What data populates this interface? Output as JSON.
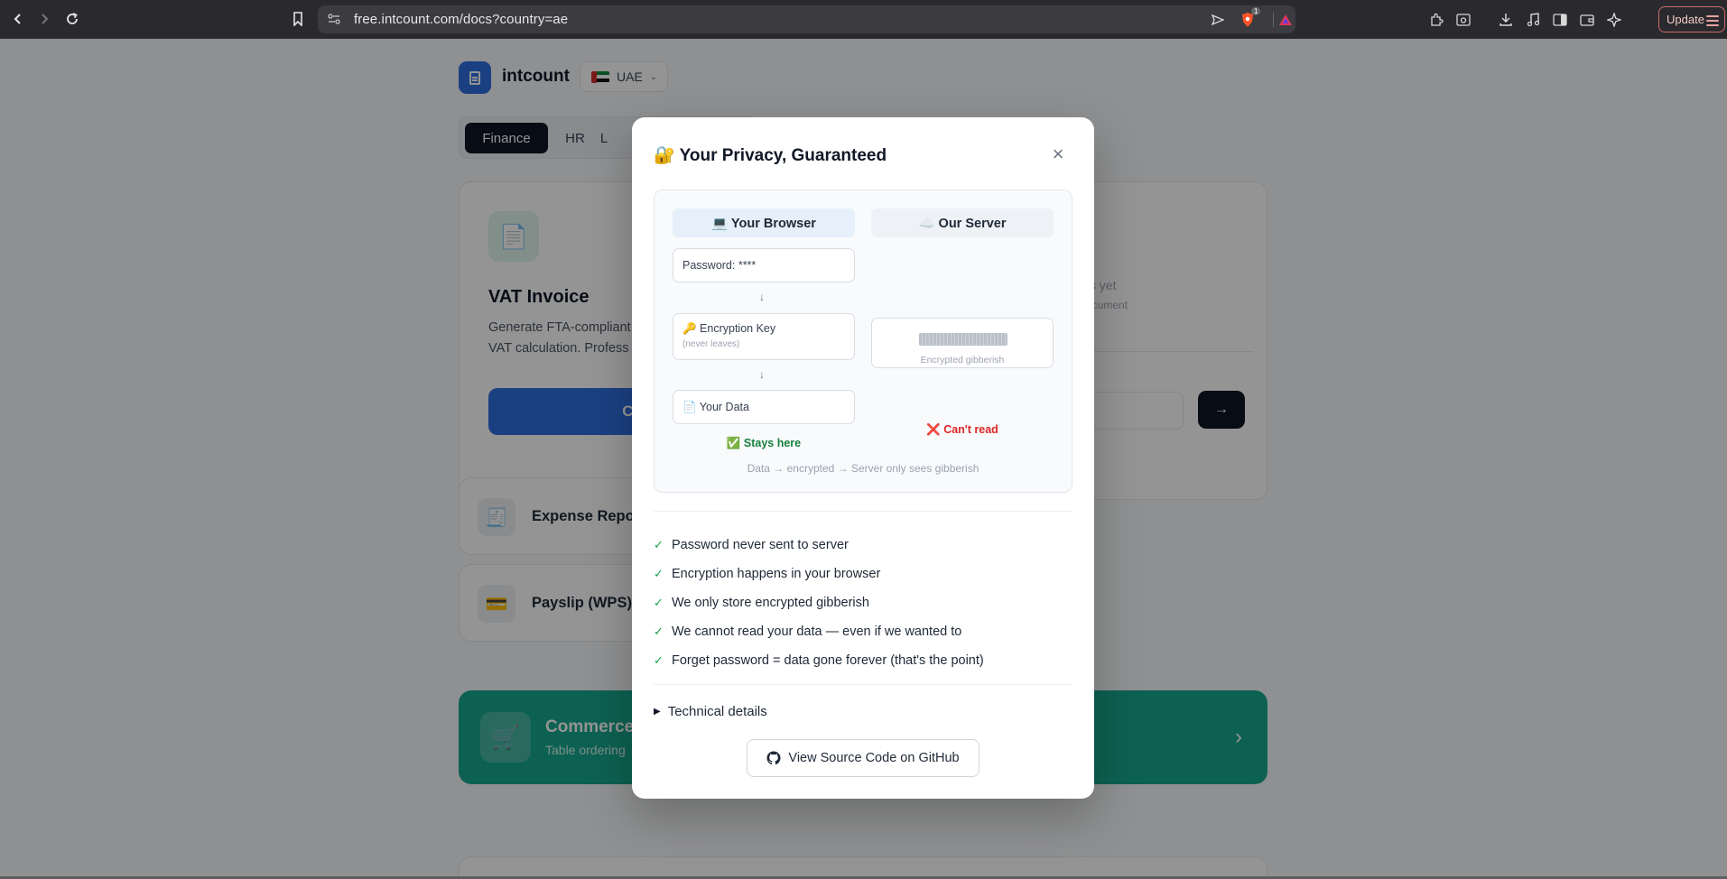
{
  "browser": {
    "url": "free.intcount.com/docs?country=ae",
    "update_label": "Update",
    "brave_badge_count": "1"
  },
  "app": {
    "brand": "intcount",
    "country": "UAE",
    "tabs": [
      {
        "label": "Finance",
        "active": true
      },
      {
        "label": "HR",
        "active": false
      },
      {
        "label": "L",
        "active": false
      }
    ]
  },
  "main_card": {
    "title": "VAT Invoice",
    "description_line1": "Generate FTA-compliant",
    "description_line2": "VAT calculation. Profess",
    "create_label": "Creat",
    "right_text1": "ts yet",
    "right_text2": "ocument",
    "go_arrow": "→"
  },
  "list_cards": [
    {
      "label": "Expense Repor",
      "icon": "receipt-icon"
    },
    {
      "label": "Payslip (WPS)",
      "icon": "card-icon"
    }
  ],
  "promo": {
    "title": "Commerce",
    "subtitle": "Table ordering",
    "icon": "cart-icon"
  },
  "modal": {
    "title": "🔐 Your Privacy, Guaranteed",
    "close_glyph": "×",
    "diagram": {
      "browser_header": "💻 Your Browser",
      "server_header": "☁️ Our Server",
      "password_box": "Password: ****",
      "key_box": "🔑 Encryption Key",
      "key_sub": "(never leaves)",
      "data_box": "📄 Your Data",
      "encrypted_label": "Encrypted gibberish",
      "stays_here": "✅ Stays here",
      "cant_read": "❌ Can't read",
      "arrow": "↓",
      "caption": "Data → encrypted → Server only sees gibberish"
    },
    "checks": [
      "Password never sent to server",
      "Encryption happens in your browser",
      "We only store encrypted gibberish",
      "We cannot read your data — even if we wanted to",
      "Forget password = data gone forever (that's the point)"
    ],
    "check_glyph": "✓",
    "technical_details": "Technical details",
    "github_button": "View Source Code on GitHub"
  }
}
